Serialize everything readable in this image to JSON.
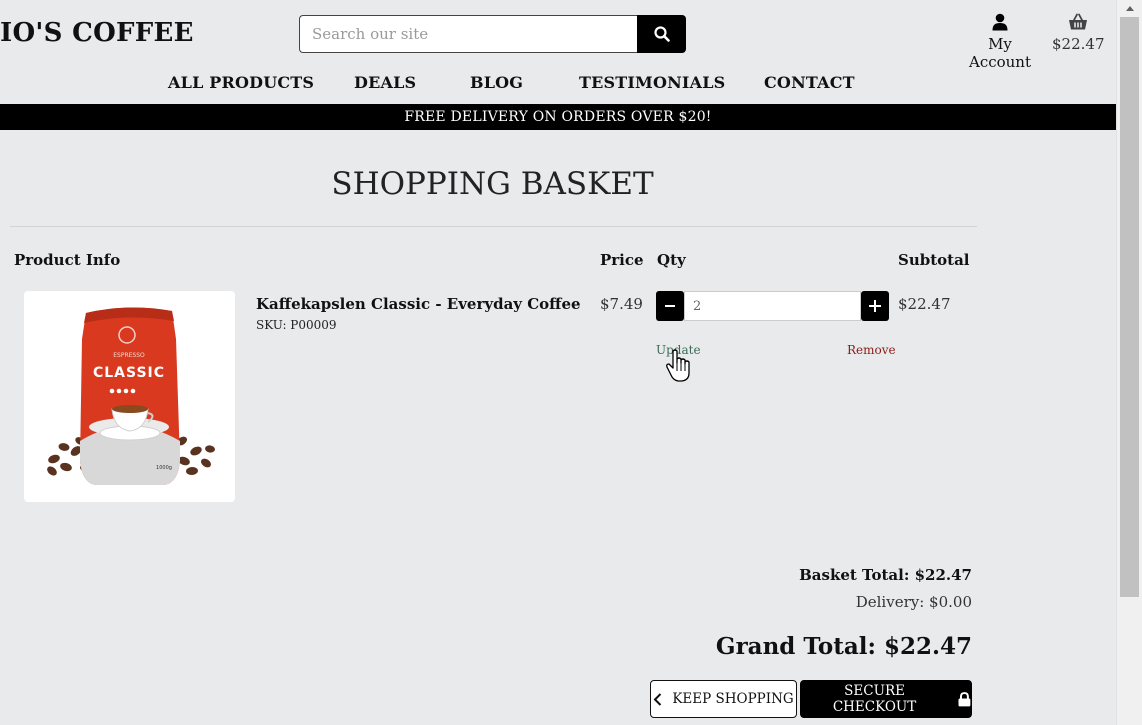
{
  "header": {
    "brand": "IO'S COFFEE",
    "search_placeholder": "Search our site",
    "account_label": "My Account",
    "basket_amount": "$22.47"
  },
  "nav": {
    "items": [
      "ALL PRODUCTS",
      "DEALS",
      "BLOG",
      "TESTIMONIALS",
      "CONTACT"
    ]
  },
  "promo": "FREE DELIVERY ON ORDERS OVER $20!",
  "page_title": "SHOPPING BASKET",
  "table": {
    "headers": {
      "product": "Product Info",
      "price": "Price",
      "qty": "Qty",
      "subtotal": "Subtotal"
    }
  },
  "item": {
    "name": "Kaffekapslen Classic - Everyday Coffee",
    "sku": "SKU: P00009",
    "price": "$7.49",
    "qty": "2",
    "subtotal": "$22.47",
    "update_label": "Update",
    "remove_label": "Remove",
    "image_text": {
      "brand": "CLASSIC",
      "line": "ESPRESSO",
      "weight": "1000g"
    }
  },
  "summary": {
    "basket_total": "Basket Total: $22.47",
    "delivery": "Delivery: $0.00",
    "grand_total": "Grand Total: $22.47"
  },
  "actions": {
    "keep_shopping": "KEEP SHOPPING",
    "secure_checkout": "SECURE CHECKOUT"
  }
}
